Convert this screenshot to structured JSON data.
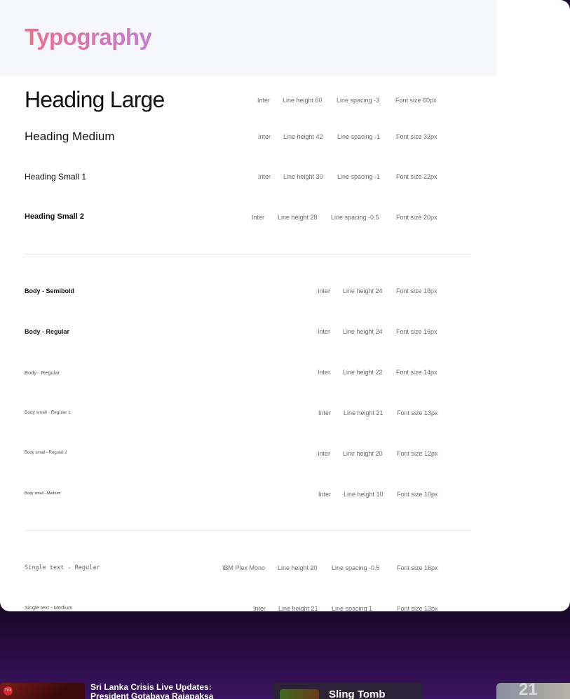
{
  "title": "Typography",
  "rows": [
    {
      "sample": "Heading Large",
      "font": "Inter",
      "line_height": "Line height 60",
      "line_spacing": "Line spacing -3",
      "font_size": "Font size 60px"
    },
    {
      "sample": "Heading Medium",
      "font": "Inter",
      "line_height": "Line height 42",
      "line_spacing": "Line spacing -1",
      "font_size": "Font size 32px"
    },
    {
      "sample": "Heading Small 1",
      "font": "Inter",
      "line_height": "Line height 30",
      "line_spacing": "Line spacing -1",
      "font_size": "Font size 22px"
    },
    {
      "sample": "Heading Small 2",
      "font": "Inter",
      "line_height": "Line height 28",
      "line_spacing": "Line spacing -0.5",
      "font_size": "Font size 20px"
    },
    {
      "sample": "Body - Semibold",
      "font": "Inter",
      "line_height": "Line height 24",
      "font_size": "Font size 16px"
    },
    {
      "sample": "Body - Regular",
      "font": "Inter",
      "line_height": "Line height 24",
      "font_size": "Font size 16px"
    },
    {
      "sample": "Body - Regular",
      "font": "Inter",
      "line_height": "Line height 22",
      "font_size": "Font size 14px"
    },
    {
      "sample": "Body small - Regular 1",
      "font": "Inter",
      "line_height": "Line height 21",
      "font_size": "Font size 13px"
    },
    {
      "sample": "Body small - Regular 2",
      "font": "Inter",
      "line_height": "Line height 20",
      "font_size": "Font size 12px"
    },
    {
      "sample": "Body small - Medium",
      "font": "Inter",
      "line_height": "Line height 10",
      "font_size": "Font size 10px"
    },
    {
      "sample": "Single text - Regular",
      "font": "IBM Plex Mono",
      "line_height": "Line height 20",
      "line_spacing": "Line spacing -0.5",
      "font_size": "Font size 16px"
    },
    {
      "sample": "Single text - Medium",
      "font": "Inter",
      "line_height": "Line height 21",
      "line_spacing": "Line spacing 1",
      "font_size": "Font size 13px"
    }
  ],
  "bottom": {
    "news_badge": "TVX",
    "news_title": "Sri Lanka Crisis Live Updates: President Gotabaya Rajapaksa",
    "game_title": "Sling Tomb",
    "side_text": "21"
  },
  "colors": {
    "title_gradient_start": "#ec6f8a",
    "title_gradient_end": "#c77ad6",
    "background": "#1c0a2c"
  }
}
